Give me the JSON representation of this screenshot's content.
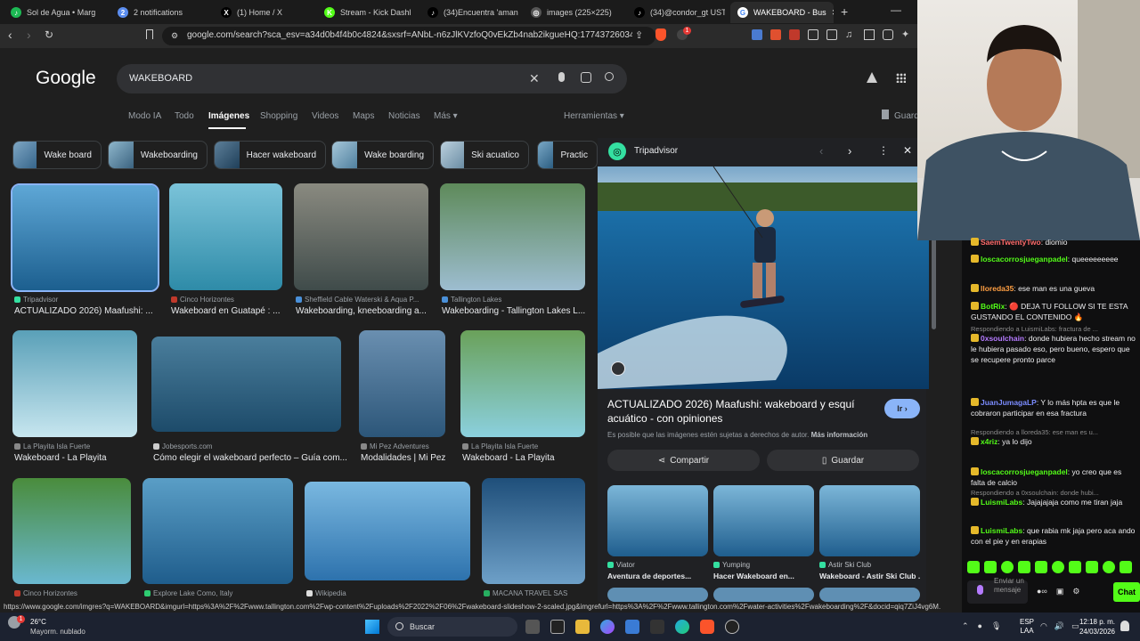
{
  "browser": {
    "tabs": [
      {
        "label": "Sol de Agua • Marg",
        "color": "#1db954",
        "glyph": "♪"
      },
      {
        "label": "2 notifications",
        "color": "#5b8def",
        "glyph": "2"
      },
      {
        "label": "(1) Home / X",
        "color": "#000000",
        "glyph": "X"
      },
      {
        "label": "Stream - Kick Dashl",
        "color": "#53fc18",
        "glyph": "K"
      },
      {
        "label": "(34)Encuentra 'amanda",
        "color": "#000000",
        "glyph": "♪"
      },
      {
        "label": "images (225×225)",
        "color": "#555555",
        "glyph": "◎"
      },
      {
        "label": "(34)@condor_gt USTED",
        "color": "#000000",
        "glyph": "♪"
      },
      {
        "label": "WAKEBOARD - Bus",
        "color": "#ffffff",
        "glyph": "G"
      }
    ],
    "new_tab": "+",
    "url": "google.com/search?sca_esv=a34d0b4f4b0c4824&sxsrf=ANbL-n6zJlKVzfoQ0vEkZb4nab2ikgueHQ:1774372603407&ud...",
    "brave_badge": "1"
  },
  "google": {
    "logo": "Google",
    "query": "WAKEBOARD",
    "nav_tabs": [
      "Modo IA",
      "Todo",
      "Imágenes",
      "Shopping",
      "Videos",
      "Maps",
      "Noticias",
      "Más ▾"
    ],
    "herramientas": "Herramientas ▾",
    "guardar": "Guard",
    "chips": [
      "Wake board",
      "Wakeboarding",
      "Hacer wakeboard",
      "Wake boarding",
      "Ski acuatico",
      "Practic"
    ],
    "results": [
      {
        "source": "Tripadvisor",
        "title": "ACTUALIZADO 2026) Maafushi: ...",
        "color": "#34e0a1"
      },
      {
        "source": "Cinco Horizontes",
        "title": "Wakeboard en Guatapé : ...",
        "color": "#c0392b"
      },
      {
        "source": "Sheffield Cable Waterski & Aqua P...",
        "title": "Wakeboarding, kneeboarding a...",
        "color": "#4a90d9"
      },
      {
        "source": "Tallington Lakes",
        "title": "Wakeboarding - Tallington Lakes L...",
        "color": "#4a90d9"
      },
      {
        "source": "La Playita Isla Fuerte",
        "title": "Wakeboard - La Playita",
        "color": "#888888"
      },
      {
        "source": "Jobesports.com",
        "title": "Cómo elegir el wakeboard perfecto – Guía com...",
        "color": "#cccccc"
      },
      {
        "source": "Mi Pez Adventures",
        "title": "Modalidades | Mi Pez",
        "color": "#888888"
      },
      {
        "source": "La Playita Isla Fuerte",
        "title": "Wakeboard - La Playita",
        "color": "#888888"
      },
      {
        "source": "Cinco Horizontes",
        "title": "",
        "color": "#c0392b"
      },
      {
        "source": "Explore Lake Como, Italy",
        "title": "",
        "color": "#2ecc71"
      },
      {
        "source": "Wikipedia",
        "title": "",
        "color": "#dddddd"
      },
      {
        "source": "MACANA TRAVEL SAS",
        "title": "",
        "color": "#27ae60"
      }
    ]
  },
  "panel": {
    "site": "Tripadvisor",
    "title": "ACTUALIZADO 2026) Maafushi: wakeboard y esquí acuático - con opiniones",
    "go": "Ir ›",
    "notice": "Es posible que las imágenes estén sujetas a derechos de autor.",
    "more_info": "Más información",
    "share": "Compartir",
    "save": "Guardar",
    "related": [
      {
        "source": "Viator",
        "title": "Aventura de deportes..."
      },
      {
        "source": "Yumping",
        "title": "Hacer Wakeboard en..."
      },
      {
        "source": "Astir Ski Club",
        "title": "Wakeboard - Astir Ski Club ..."
      }
    ]
  },
  "status_url": "https://www.google.com/imgres?q=WAKEBOARD&imgurl=https%3A%2F%2Fwww.tallington.com%2Fwp-content%2Fuploads%2F2022%2F06%2Fwakeboard-slideshow-2-scaled.jpg&imgrefurl=https%3A%2F%2Fwww.tallington.com%2Fwater-activities%2Fwakeboarding%2F&docid=qiq7ZiJ4vg6M...",
  "taskbar": {
    "temp": "26°C",
    "weather": "Mayorm. nublado",
    "weather_badge": "1",
    "search": "Buscar",
    "lang1": "ESP",
    "lang2": "LAA",
    "time": "12:18 p. m.",
    "date": "24/03/2026"
  },
  "chat": {
    "messages": [
      {
        "user": "SaemTwentyTwo",
        "text": "diomio",
        "color": "#ff6b6b",
        "reply": ""
      },
      {
        "user": "loscacorrosjueganpadel",
        "text": "queeeeeeeee",
        "color": "#53fc18",
        "reply": ""
      },
      {
        "user": "lloreda35",
        "text": "ese man es una gueva",
        "color": "#ff9f43",
        "reply": ""
      },
      {
        "user": "BotRix",
        "text": "🔴 DEJA TU FOLLOW SI TE ESTA GUSTANDO EL CONTENIDO 🔥",
        "color": "#53fc18",
        "reply": ""
      },
      {
        "user": "0xsoulchain",
        "text": "donde hubiera hecho stream no le hubiera pasado eso, pero bueno, espero que se recupere pronto parce",
        "color": "#b57bff",
        "reply": "Respondiendo a LuismiLabs: fractura de ..."
      },
      {
        "user": "JuanJumagaLP",
        "text": "Y lo más hpta es que le cobraron participar en esa fractura",
        "color": "#7b8cff",
        "reply": ""
      },
      {
        "user": "x4riz",
        "text": "ya lo dijo",
        "color": "#53fc18",
        "reply": "Respondiendo a lloreda35: ese man es u..."
      },
      {
        "user": "loscacorrosjueganpadel",
        "text": "yo creo que es falta de calcio",
        "color": "#53fc18",
        "reply": ""
      },
      {
        "user": "LuismiLabs",
        "text": "Jajajajaja como me tiran jaja",
        "color": "#53fc18",
        "reply": "Respondiendo a 0xsoulchain: donde hubi..."
      },
      {
        "user": "LuismiLabs",
        "text": "que rabia mk jaja pero aca ando con el pie y en erapias",
        "color": "#53fc18",
        "reply": ""
      }
    ],
    "input_placeholder": "Enviar un mensaje",
    "chat_button": "Chat"
  }
}
